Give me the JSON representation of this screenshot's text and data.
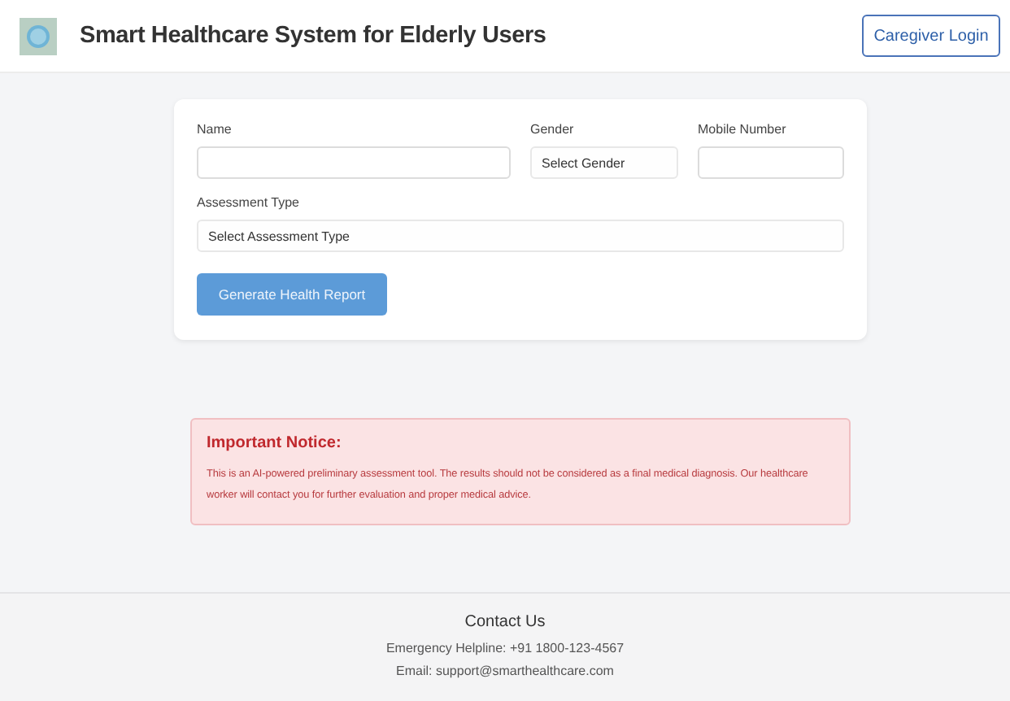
{
  "header": {
    "title": "Smart Healthcare System for Elderly Users",
    "login_button": "Caregiver Login"
  },
  "form": {
    "fields": [
      {
        "kind": "text",
        "label": "Name"
      },
      {
        "kind": "select",
        "label": "Gender",
        "value": "Select Gender"
      },
      {
        "kind": "text",
        "label": "Mobile Number"
      },
      {
        "kind": "select",
        "label": "Assessment Type",
        "value": "Select Assessment Type"
      }
    ],
    "submit_button": "Generate Health Report"
  },
  "notice": {
    "title": "Important Notice:",
    "text": "This is an AI-powered preliminary assessment tool. The results should not be considered as a final medical diagnosis. Our healthcare worker will contact you for further evaluation and proper medical advice."
  },
  "footer": {
    "title": "Contact Us",
    "lines": [
      "Emergency Helpline: +91 1800-123-4567",
      "Email: support@smarthealthcare.com"
    ]
  }
}
